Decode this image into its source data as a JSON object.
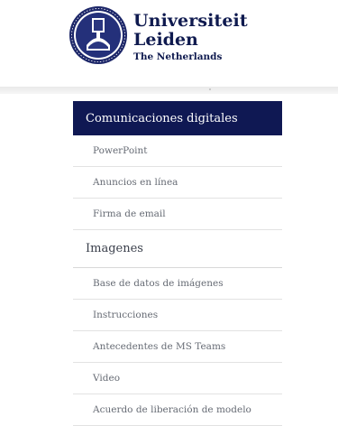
{
  "brand": {
    "line1": "Universiteit",
    "line2": "Leiden",
    "line3": "The Netherlands"
  },
  "menu": {
    "header": "Comunicaciones digitales",
    "group1": [
      "PowerPoint",
      "Anuncios en línea",
      "Firma de email"
    ],
    "section2_title": "Imagenes",
    "group2": [
      "Base de datos de imágenes",
      "Instrucciones",
      "Antecedentes de MS Teams",
      "Video",
      "Acuerdo de liberación de modelo"
    ]
  },
  "colors": {
    "navy": "#0f1853",
    "text": "#666b74",
    "divider": "#e2e2e2"
  }
}
